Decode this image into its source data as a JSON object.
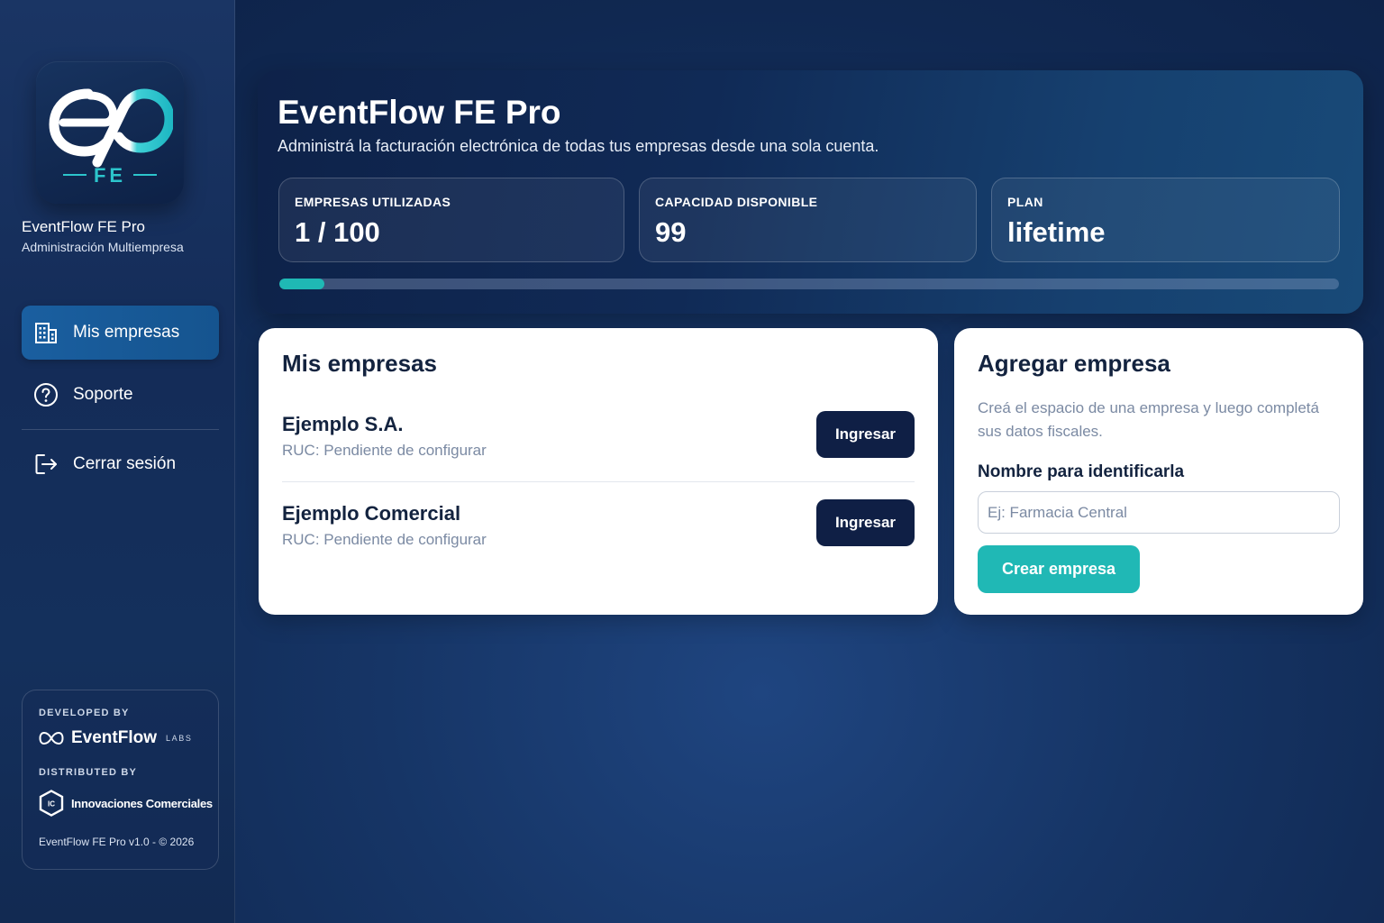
{
  "sidebar": {
    "logo_text": "FE",
    "brand_name": "EventFlow FE Pro",
    "brand_subtitle": "Administración Multiempresa",
    "nav": [
      {
        "label": "Mis empresas",
        "icon": "building-icon",
        "active": true
      },
      {
        "label": "Soporte",
        "icon": "help-circle-icon",
        "active": false
      },
      {
        "label": "Cerrar sesión",
        "icon": "logout-icon",
        "active": false
      }
    ],
    "credits": {
      "developed_by_caption": "DEVELOPED BY",
      "developer_name": "EventFlow",
      "developer_suffix": "LABS",
      "distributed_by_caption": "DISTRIBUTED BY",
      "distributor_logo_text": "IC",
      "distributor_name": "Innovaciones Comerciales",
      "version": "EventFlow FE Pro v1.0 - © 2026"
    }
  },
  "hero": {
    "title": "EventFlow FE Pro",
    "subtitle": "Administrá la facturación electrónica de todas tus empresas desde una sola cuenta.",
    "stats": [
      {
        "label": "EMPRESAS UTILIZADAS",
        "value": "1 / 100"
      },
      {
        "label": "CAPACIDAD DISPONIBLE",
        "value": "99"
      },
      {
        "label": "PLAN",
        "value": "lifetime"
      }
    ],
    "usage_fraction": 0.01
  },
  "companies_card": {
    "title": "Mis empresas",
    "items": [
      {
        "name": "Ejemplo S.A.",
        "ruc": "RUC: Pendiente de configurar",
        "button": "Ingresar"
      },
      {
        "name": "Ejemplo Comercial",
        "ruc": "RUC: Pendiente de configurar",
        "button": "Ingresar"
      }
    ]
  },
  "add_card": {
    "title": "Agregar empresa",
    "description": "Creá el espacio de una empresa y luego completá sus datos fiscales.",
    "field_label": "Nombre para identificarla",
    "input_value": "",
    "input_placeholder": "Ej: Farmacia Central",
    "submit_label": "Crear empresa"
  },
  "colors": {
    "accent": "#20b8b5",
    "dark_button": "#0f1f45",
    "active_nav": "#1a5fa0",
    "muted_text": "#7b8aa3"
  }
}
